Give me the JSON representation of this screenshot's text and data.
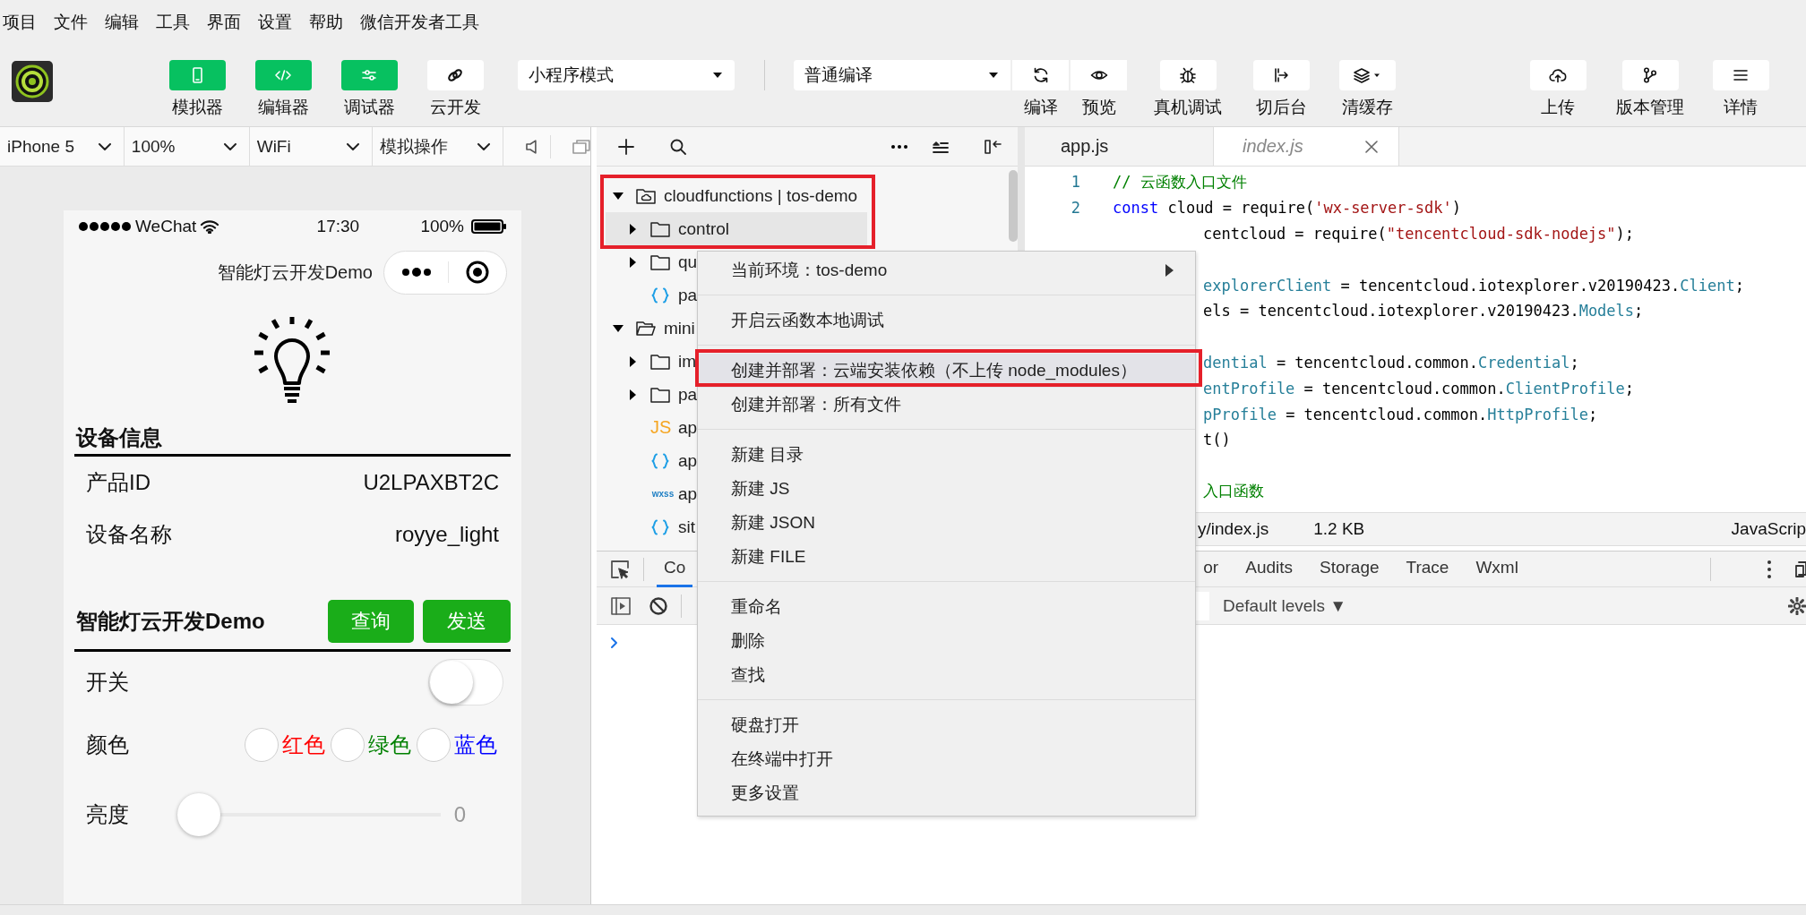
{
  "menu_bar": [
    "项目",
    "文件",
    "编辑",
    "工具",
    "界面",
    "设置",
    "帮助",
    "微信开发者工具"
  ],
  "toolbar": {
    "view_buttons": [
      {
        "label": "模拟器",
        "on": true
      },
      {
        "label": "编辑器",
        "on": true
      },
      {
        "label": "调试器",
        "on": true
      },
      {
        "label": "云开发",
        "on": false
      }
    ],
    "mode_select": "小程序模式",
    "compile_select": "普通编译",
    "compile_buttons": [
      "编译",
      "预览"
    ],
    "action_buttons": [
      "真机调试",
      "切后台",
      "清缓存",
      "上传",
      "版本管理",
      "详情"
    ]
  },
  "simulator": {
    "toolbar": [
      "iPhone 5",
      "100%",
      "WiFi",
      "模拟操作"
    ],
    "phone": {
      "status_bar": {
        "carrier": "WeChat",
        "time": "17:30",
        "battery": "100%"
      },
      "nav_title": "智能灯云开发Demo",
      "info_section": {
        "title": "设备信息",
        "rows": [
          {
            "label": "产品ID",
            "value": "U2LPAXBT2C"
          },
          {
            "label": "设备名称",
            "value": "royye_light"
          }
        ]
      },
      "control_section": {
        "title": "智能灯云开发Demo",
        "buttons": [
          "查询",
          "发送"
        ],
        "switch": {
          "label": "开关",
          "on": false
        },
        "color": {
          "label": "颜色",
          "options": [
            {
              "label": "红色",
              "color": "#ff0000",
              "checked": false
            },
            {
              "label": "绿色",
              "color": "#008000",
              "checked": false
            },
            {
              "label": "蓝色",
              "color": "#0000ff",
              "checked": false
            }
          ]
        },
        "brightness": {
          "label": "亮度",
          "level": 0,
          "reading": "0"
        }
      }
    }
  },
  "file_tree": {
    "items": [
      {
        "label": "cloudfunctions | tos-demo",
        "kind": "cloud-folder",
        "expanded": true,
        "selected": false,
        "children": [
          {
            "label": "control",
            "kind": "folder",
            "expanded": false,
            "selected": true
          },
          {
            "label": "qu",
            "kind": "folder",
            "expanded": false,
            "selected": false
          },
          {
            "label": "pa",
            "kind": "json",
            "selected": false
          }
        ]
      },
      {
        "label": "mini",
        "kind": "folder",
        "expanded": true,
        "selected": false,
        "children": [
          {
            "label": "im",
            "kind": "folder",
            "expanded": false,
            "selected": false
          },
          {
            "label": "pa",
            "kind": "folder",
            "expanded": false,
            "selected": false
          },
          {
            "label": "ap",
            "kind": "js",
            "icon_text": "JS",
            "selected": false
          },
          {
            "label": "ap",
            "kind": "json",
            "selected": false
          },
          {
            "label": "ap",
            "kind": "wxss",
            "icon_text": "wxss",
            "selected": false
          },
          {
            "label": "sit",
            "kind": "json",
            "selected": false
          }
        ]
      }
    ]
  },
  "editor": {
    "tabs": [
      {
        "label": "app.js",
        "selected": false
      },
      {
        "label": "index.js",
        "selected": true
      }
    ],
    "lines": [
      {
        "kind": "full",
        "number": "1",
        "tokens": [
          {
            "kind": "comment",
            "text": "// 云函数入口文件"
          }
        ]
      },
      {
        "kind": "full",
        "number": "2",
        "tokens": [
          {
            "kind": "keyword",
            "text": "const"
          },
          {
            "kind": "plain",
            "text": " cloud = require("
          },
          {
            "kind": "string",
            "text": "'wx-server-sdk'"
          },
          {
            "kind": "plain",
            "text": ")"
          }
        ]
      },
      {
        "kind": "partial",
        "tokens": [
          {
            "kind": "plain",
            "text": "centcloud = require("
          },
          {
            "kind": "string",
            "text": "\"tencentcloud-sdk-nodejs\""
          },
          {
            "kind": "plain",
            "text": ");"
          }
        ]
      },
      {
        "kind": "blank"
      },
      {
        "kind": "partial",
        "tokens": [
          {
            "kind": "type",
            "text": "explorerClient"
          },
          {
            "kind": "plain",
            "text": " = tencentcloud.iotexplorer.v20190423."
          },
          {
            "kind": "type",
            "text": "Client"
          },
          {
            "kind": "plain",
            "text": ";"
          }
        ]
      },
      {
        "kind": "partial",
        "tokens": [
          {
            "kind": "plain",
            "text": "els = tencentcloud.iotexplorer.v20190423."
          },
          {
            "kind": "type",
            "text": "Models"
          },
          {
            "kind": "plain",
            "text": ";"
          }
        ]
      },
      {
        "kind": "blank"
      },
      {
        "kind": "partial",
        "tokens": [
          {
            "kind": "type",
            "text": "dential"
          },
          {
            "kind": "plain",
            "text": " = tencentcloud.common."
          },
          {
            "kind": "type",
            "text": "Credential"
          },
          {
            "kind": "plain",
            "text": ";"
          }
        ]
      },
      {
        "kind": "partial",
        "tokens": [
          {
            "kind": "type",
            "text": "entProfile"
          },
          {
            "kind": "plain",
            "text": " = tencentcloud.common."
          },
          {
            "kind": "type",
            "text": "ClientProfile"
          },
          {
            "kind": "plain",
            "text": ";"
          }
        ]
      },
      {
        "kind": "partial",
        "tokens": [
          {
            "kind": "type",
            "text": "pProfile"
          },
          {
            "kind": "plain",
            "text": " = tencentcloud.common."
          },
          {
            "kind": "type",
            "text": "HttpProfile"
          },
          {
            "kind": "plain",
            "text": ";"
          }
        ]
      },
      {
        "kind": "partial",
        "tokens": [
          {
            "kind": "plain",
            "text": "t()"
          }
        ]
      },
      {
        "kind": "blank"
      },
      {
        "kind": "partial",
        "tokens": [
          {
            "kind": "comment",
            "text": "入口函数"
          }
        ]
      }
    ],
    "status_bar": [
      "y/index.js",
      "1.2 KB",
      "JavaScrip"
    ]
  },
  "devtools": {
    "tabs": [
      {
        "label": "Co",
        "selected": true
      },
      {
        "label": "or",
        "selected": false
      },
      {
        "label": "Audits",
        "selected": false
      },
      {
        "label": "Storage",
        "selected": false
      },
      {
        "label": "Trace",
        "selected": false
      },
      {
        "label": "Wxml",
        "selected": false
      }
    ],
    "levels_button": "Default levels ▼"
  },
  "context_menu": {
    "items": [
      {
        "kind": "item",
        "label": "当前环境：tos-demo",
        "submenu": true,
        "selected": false
      },
      {
        "kind": "separator"
      },
      {
        "kind": "item",
        "label": "开启云函数本地调试",
        "submenu": false,
        "selected": false
      },
      {
        "kind": "separator"
      },
      {
        "kind": "item",
        "label": "创建并部署：云端安装依赖（不上传 node_modules）",
        "submenu": false,
        "selected": true
      },
      {
        "kind": "item",
        "label": "创建并部署：所有文件",
        "submenu": false,
        "selected": false
      },
      {
        "kind": "separator"
      },
      {
        "kind": "item",
        "label": "新建 目录",
        "submenu": false,
        "selected": false
      },
      {
        "kind": "item",
        "label": "新建 JS",
        "submenu": false,
        "selected": false
      },
      {
        "kind": "item",
        "label": "新建 JSON",
        "submenu": false,
        "selected": false
      },
      {
        "kind": "item",
        "label": "新建 FILE",
        "submenu": false,
        "selected": false
      },
      {
        "kind": "separator"
      },
      {
        "kind": "item",
        "label": "重命名",
        "submenu": false,
        "selected": false
      },
      {
        "kind": "item",
        "label": "删除",
        "submenu": false,
        "selected": false
      },
      {
        "kind": "item",
        "label": "查找",
        "submenu": false,
        "selected": false
      },
      {
        "kind": "separator"
      },
      {
        "kind": "item",
        "label": "硬盘打开",
        "submenu": false,
        "selected": false
      },
      {
        "kind": "item",
        "label": "在终端中打开",
        "submenu": false,
        "selected": false
      },
      {
        "kind": "item",
        "label": "更多设置",
        "submenu": false,
        "selected": false
      }
    ]
  },
  "callouts": [
    {
      "kind": "box"
    },
    {
      "kind": "box"
    }
  ]
}
